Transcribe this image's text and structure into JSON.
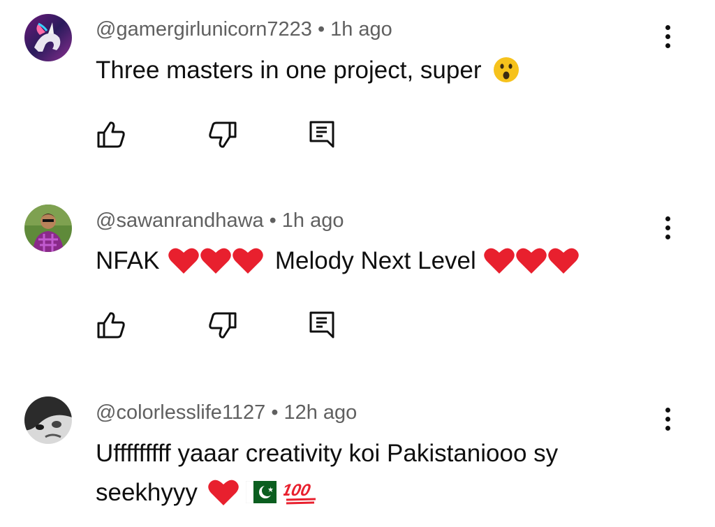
{
  "comments": [
    {
      "handle": "@gamergirlunicorn7223",
      "sep": "•",
      "time": "1h ago",
      "text": "Three masters in one project, super",
      "emojis": [
        "astonished-face"
      ]
    },
    {
      "handle": "@sawanrandhawa",
      "sep": "•",
      "time": "1h ago",
      "text_parts": [
        "NFAK",
        "Melody Next Level"
      ],
      "emojis": [
        "red-heart",
        "red-heart",
        "red-heart",
        "red-heart",
        "red-heart",
        "red-heart"
      ]
    },
    {
      "handle": "@colorlesslife1127",
      "sep": "•",
      "time": "12h ago",
      "text_line1": "Ufffffffff yaaar creativity koi Pakistaniooo sy",
      "text_line2": "seekhyyy",
      "emojis": [
        "red-heart",
        "pakistan-flag",
        "hundred-points"
      ],
      "hundred_text": "100"
    }
  ],
  "icons": {
    "like": "thumb-up-icon",
    "dislike": "thumb-down-icon",
    "reply": "reply-comment-icon",
    "more": "more-vert-icon"
  },
  "colors": {
    "heart": "#e8202e",
    "meta": "#606060",
    "text": "#0f0f0f",
    "flag": "#0b5e1f"
  }
}
